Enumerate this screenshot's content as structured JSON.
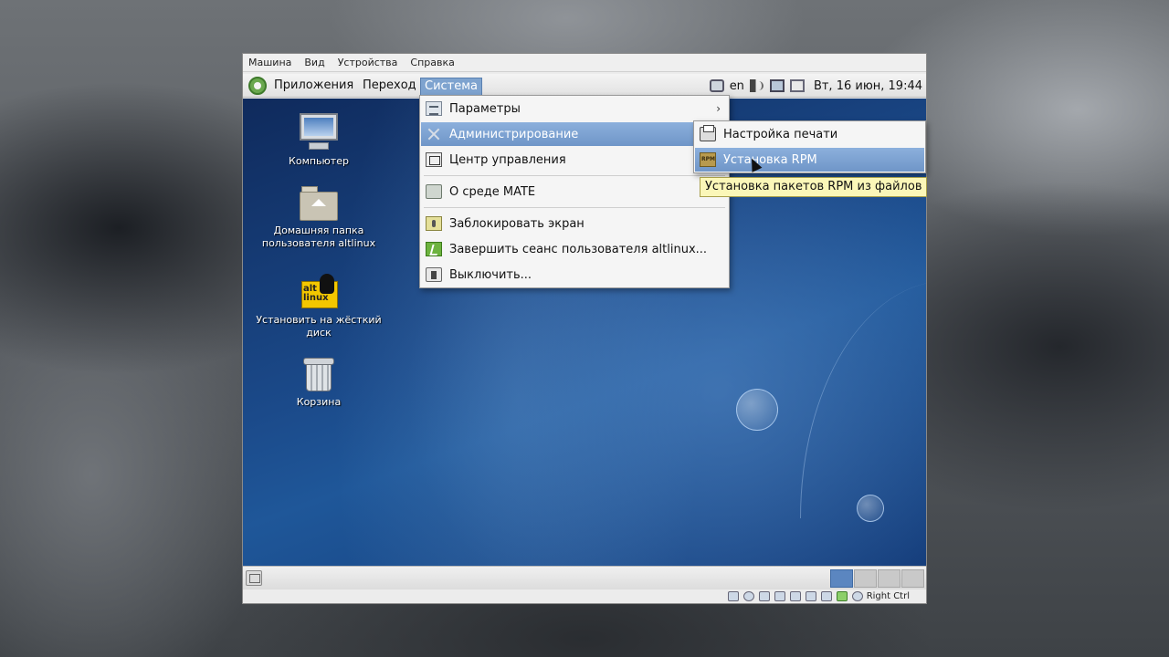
{
  "vm": {
    "menubar": [
      "Машина",
      "Вид",
      "Устройства",
      "Справка"
    ],
    "status": {
      "host_key": "Right Ctrl"
    }
  },
  "panel": {
    "menus": [
      "Приложения",
      "Переход",
      "Система"
    ],
    "active_menu": "Система",
    "tray": {
      "lang": "en",
      "clock": "Вт, 16 июн, 19:44"
    }
  },
  "desktop": {
    "icons": [
      {
        "label": "Компьютер",
        "icon": "computer-icon"
      },
      {
        "label": "Домашняя папка пользователя altlinux",
        "icon": "home-folder-icon"
      },
      {
        "label": "Установить на жёсткий диск",
        "icon": "altlinux-installer-icon",
        "icon_text": "alt linux"
      },
      {
        "label": "Корзина",
        "icon": "trash-icon"
      }
    ]
  },
  "system_menu": {
    "items": [
      {
        "label": "Параметры",
        "icon": "preferences-icon",
        "submenu": true
      },
      {
        "label": "Администрирование",
        "icon": "administration-icon",
        "submenu": true,
        "highlighted": true
      },
      {
        "label": "Центр управления",
        "icon": "control-center-icon"
      },
      {
        "label": "О среде MATE",
        "icon": "about-icon"
      },
      {
        "label": "Заблокировать экран",
        "icon": "lock-screen-icon"
      },
      {
        "label": "Завершить сеанс пользователя altlinux...",
        "icon": "logout-icon"
      },
      {
        "label": "Выключить...",
        "icon": "shutdown-icon"
      }
    ]
  },
  "admin_submenu": {
    "items": [
      {
        "label": "Настройка печати",
        "icon": "printer-icon"
      },
      {
        "label": "Установка RPM",
        "icon": "rpm-icon",
        "highlighted": true
      }
    ],
    "tooltip": "Установка пакетов RPM из файлов"
  },
  "colors": {
    "menu_highlight": "#7ea3cf",
    "desktop_blue": "#1b4a8a",
    "workspace_active": "#5b86c0"
  }
}
